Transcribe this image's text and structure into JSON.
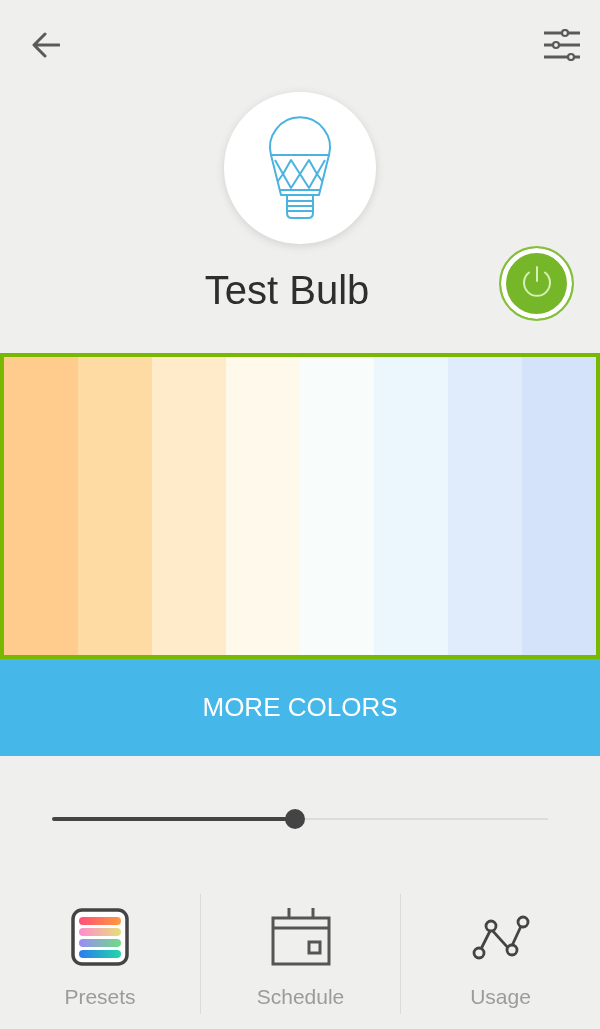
{
  "device": {
    "name": "Test Bulb",
    "on": true
  },
  "swatches": [
    {
      "color": "#ffcc8d"
    },
    {
      "color": "#ffdba4"
    },
    {
      "color": "#ffebca"
    },
    {
      "color": "#fff9ec"
    },
    {
      "color": "#f8fcfa"
    },
    {
      "color": "#ecf6fd"
    },
    {
      "color": "#e0ecfb"
    },
    {
      "color": "#d4e3fa"
    }
  ],
  "more_colors_button": {
    "label": "MORE COLORS"
  },
  "brightness": {
    "level": 0.49
  },
  "nav": [
    {
      "label": "Presets",
      "kind": "presets"
    },
    {
      "label": "Schedule",
      "kind": "schedule"
    },
    {
      "label": "Usage",
      "kind": "usage"
    }
  ]
}
